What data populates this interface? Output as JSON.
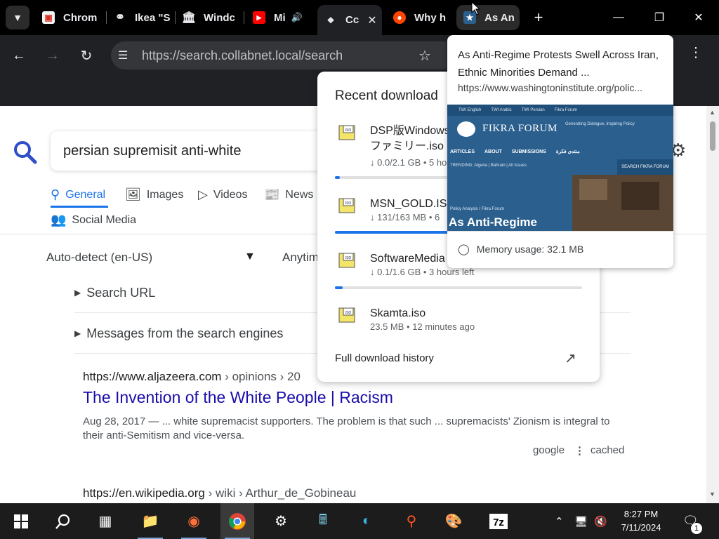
{
  "tabs": [
    {
      "title": "Chrom",
      "favicon": "chrome-page-icon"
    },
    {
      "title": "Ikea \"S",
      "favicon": "globe-icon"
    },
    {
      "title": "Windc",
      "favicon": "building-icon"
    },
    {
      "title": "Mi",
      "favicon": "youtube-icon"
    },
    {
      "title": "Cc",
      "favicon": "collabnet-icon",
      "active": true
    },
    {
      "title": "Why h",
      "favicon": "reddit-icon"
    },
    {
      "title": "As An",
      "favicon": "fikra-icon"
    }
  ],
  "toolbar": {
    "url": "https://search.collabnet.local/search"
  },
  "search": {
    "query": "persian supremisit anti-white",
    "categories": [
      {
        "label": "General",
        "icon": "search-icon",
        "active": true
      },
      {
        "label": "Images",
        "icon": "image-icon"
      },
      {
        "label": "Videos",
        "icon": "play-icon"
      },
      {
        "label": "News",
        "icon": "news-icon"
      },
      {
        "label": "Social Media",
        "icon": "people-icon"
      }
    ],
    "language": "Auto-detect (en-US)",
    "time": "Anytim",
    "search_url_label": "Search URL",
    "messages_label": "Messages from the search engines"
  },
  "results": [
    {
      "url_domain": "https://www.aljazeera.com",
      "url_path": "› opinions › 20",
      "title": "The Invention of the White People | Racism",
      "snippet": "Aug 28, 2017 — ... white supremacist supporters. The problem is that such ... supremacists' Zionism is integral to their anti-Semitism and vice-versa.",
      "engine": "google",
      "cached": "cached"
    },
    {
      "url_domain": "https://en.wikipedia.org",
      "url_path": "› wiki › Arthur_de_Gobineau"
    }
  ],
  "downloads": {
    "title": "Recent download",
    "items": [
      {
        "name": "DSP版Windows",
        "name2": "ファミリー.iso",
        "status": "↓ 0.0/2.1 GB • 5 ho",
        "progress": 0.02
      },
      {
        "name": "MSN_GOLD.ISO",
        "status": "↓ 131/163 MB • 6",
        "progress": 0.8
      },
      {
        "name": "SoftwareMedia",
        "status": "↓ 0.1/1.6 GB • 3 hours left",
        "progress": 0.03
      },
      {
        "name": "Skamta.iso",
        "status": "23.5 MB • 12 minutes ago"
      }
    ],
    "history_label": "Full download history"
  },
  "hovercard": {
    "title": "As Anti-Regime Protests Swell Across Iran, Ethnic Minorities Demand ...",
    "url": "https://www.washingtoninstitute.org/polic...",
    "memory": "Memory usage: 32.1 MB",
    "preview": {
      "topbar": [
        "TWI English",
        "TWI Arabic",
        "TWI Persian",
        "Fikra Forum"
      ],
      "brand": "FIKRA FORUM",
      "tagline": "Generating Dialogue, Inspiring Policy",
      "nav": [
        "ARTICLES",
        "ABOUT",
        "SUBMISSIONS",
        "منتدى فكرة"
      ],
      "trending": "TRENDING: Algeria | Bahrain | All Issues",
      "search": "SEARCH FIKRA FORUM",
      "breadcrumb": "Policy Analysis / Fikra Forum",
      "headline": "As Anti-Regime"
    }
  },
  "taskbar": {
    "time": "8:27 PM",
    "date": "7/11/2024",
    "notifications": "1"
  },
  "colors": {
    "accent": "#1a73e8",
    "link": "#1a0dab",
    "chrome_dark": "#202124"
  }
}
